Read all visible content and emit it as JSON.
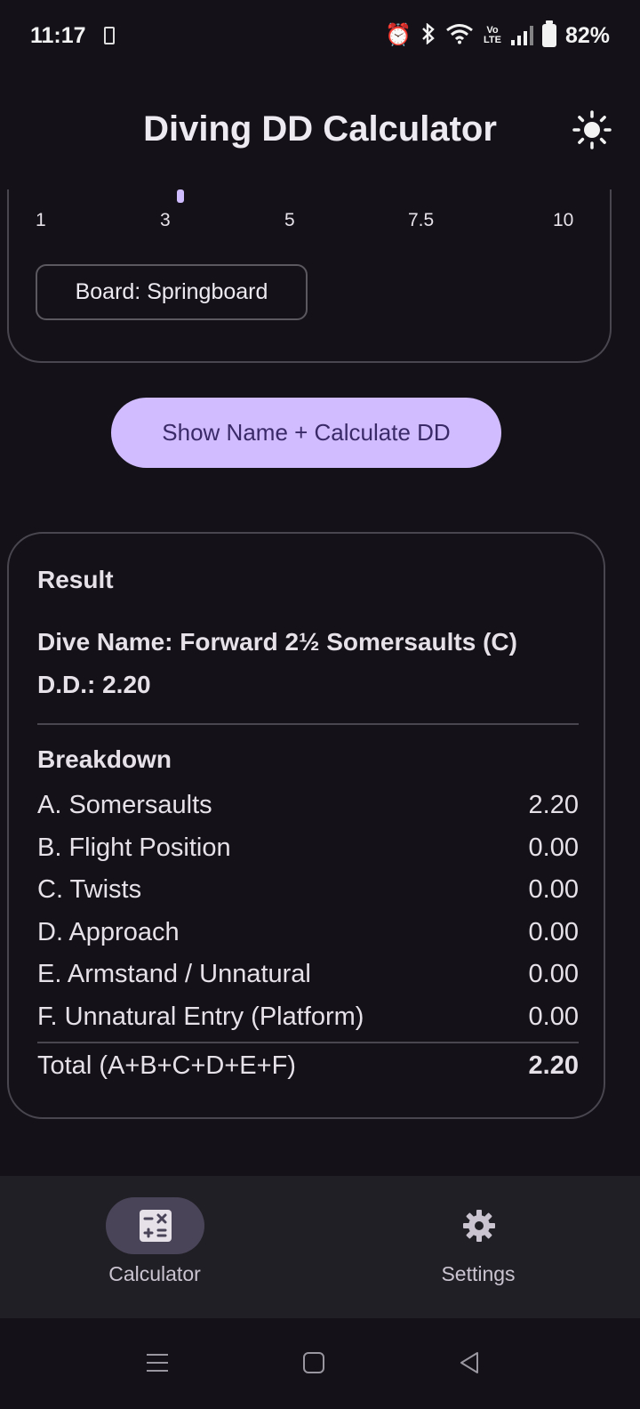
{
  "status_bar": {
    "time": "11:17",
    "battery_percent": "82%",
    "network_label": "Vo LTE"
  },
  "app_bar": {
    "title": "Diving DD Calculator",
    "theme_icon": "sun-icon"
  },
  "height_slider": {
    "ticks": [
      "1",
      "3",
      "5",
      "7.5",
      "10"
    ],
    "selected_value": 3
  },
  "board_selector": {
    "label": "Board: Springboard"
  },
  "calculate_button": {
    "label": "Show Name + Calculate DD"
  },
  "result": {
    "title": "Result",
    "dive_name": "Dive Name: Forward 2½ Somersaults (C)",
    "dd": "D.D.: 2.20",
    "breakdown_title": "Breakdown",
    "breakdown": [
      {
        "label": "A. Somersaults",
        "value": "2.20"
      },
      {
        "label": "B. Flight Position",
        "value": "0.00"
      },
      {
        "label": "C. Twists",
        "value": "0.00"
      },
      {
        "label": "D. Approach",
        "value": "0.00"
      },
      {
        "label": "E. Armstand / Unnatural",
        "value": "0.00"
      },
      {
        "label": "F. Unnatural Entry (Platform)",
        "value": "0.00"
      }
    ],
    "total_label": "Total (A+B+C+D+E+F)",
    "total_value": "2.20"
  },
  "bottom_nav": {
    "items": [
      {
        "label": "Calculator",
        "icon": "calculator-icon",
        "selected": true
      },
      {
        "label": "Settings",
        "icon": "gear-icon",
        "selected": false
      }
    ]
  },
  "colors": {
    "background": "#141218",
    "accent": "#d0bcff",
    "nav_pill": "#4a4458"
  }
}
